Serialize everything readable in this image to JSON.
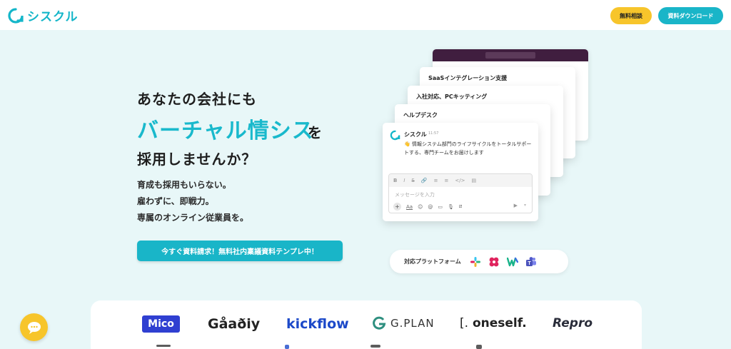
{
  "brand": {
    "name": "シスクル",
    "color": "#14b6c9"
  },
  "header": {
    "consult_label": "無料相談",
    "download_label": "資料ダウンロード"
  },
  "hero": {
    "line1": "あなたの会社にも",
    "line2": "バーチャル情シス",
    "line2_suffix": "を",
    "line3": "採用しませんか？",
    "features": [
      "育成も採用もいらない。",
      "雇わずに、即戦力。",
      "専属のオンライン従業員を。"
    ],
    "cta_label": "今すぐ資料請求！無料社内稟議資料テンプレ中！"
  },
  "mockup": {
    "cards": [
      {
        "title": "SaaSインテグレーション支援"
      },
      {
        "title": "入社対応、PCキッティング"
      },
      {
        "title": "ヘルプデスク"
      }
    ],
    "message": {
      "sender": "シスクル",
      "time": "11:57",
      "body": "👋 情報システム部門のライフサイクルをトータルサポートする、専門チームをお届けします"
    },
    "composer": {
      "placeholder": "メッセージを入力",
      "format_icons": [
        "B",
        "I",
        "S",
        "🔗",
        "≡",
        "≡",
        "</>",
        "▤"
      ],
      "action_icons": [
        "Aa",
        "☺",
        "@",
        "▭",
        "🎙",
        "⧄"
      ]
    }
  },
  "platforms": {
    "label": "対応プラットフォーム",
    "icons": [
      "slack-icon",
      "workplace-icon",
      "works-icon",
      "teams-icon"
    ]
  },
  "clients": [
    {
      "name": "Mico"
    },
    {
      "name": "Gåaðiy"
    },
    {
      "name": "kickflow"
    },
    {
      "name": "G.PLAN"
    },
    {
      "name": "oneself."
    },
    {
      "name": "Repro"
    }
  ]
}
